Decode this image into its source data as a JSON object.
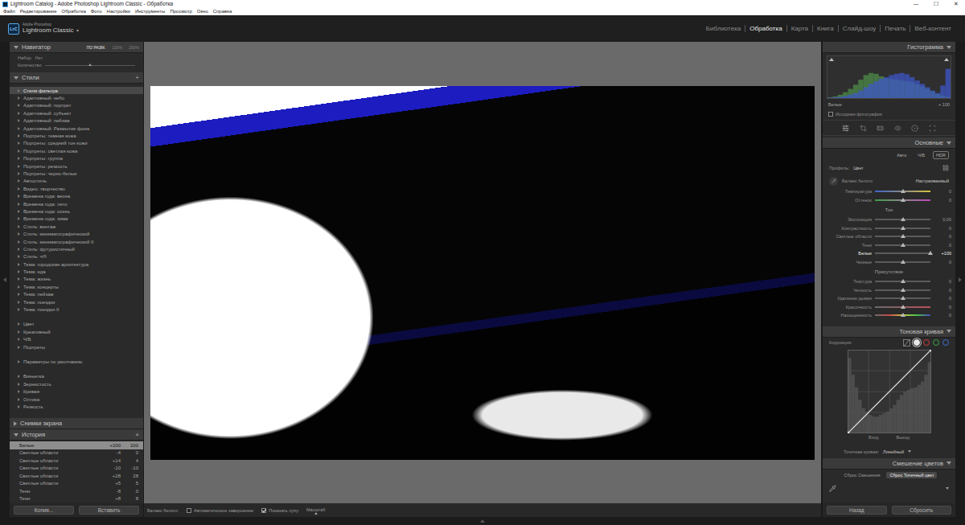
{
  "window": {
    "title": "Lightroom Catalog - Adobe Photoshop Lightroom Classic - Обработка",
    "controls": [
      "—",
      "☐",
      "✕"
    ]
  },
  "menu": [
    "Файл",
    "Редактирование",
    "Обработка",
    "Фото",
    "Настройки",
    "Инструменты",
    "Просмотр",
    "Окно",
    "Справка"
  ],
  "identity": {
    "logo": "LrC",
    "vendor": "Adobe Photoshop",
    "product": "Lightroom Classic",
    "caret": "▾"
  },
  "modules": [
    {
      "label": "Библиотека",
      "selected": false
    },
    {
      "label": "Обработка",
      "selected": true
    },
    {
      "label": "Карта",
      "selected": false
    },
    {
      "label": "Книга",
      "selected": false
    },
    {
      "label": "Слайд-шоу",
      "selected": false
    },
    {
      "label": "Печать",
      "selected": false
    },
    {
      "label": "Веб-контент",
      "selected": false
    }
  ],
  "left_panel": {
    "navigator": {
      "title": "Навигатор",
      "expanded": true,
      "zoom": [
        {
          "label": "ПО РАЗМ.",
          "selected": true
        },
        {
          "label": "100%",
          "selected": false
        },
        {
          "label": "200%",
          "selected": false
        }
      ],
      "preset_label": "Набор:",
      "preset_value": "Нет",
      "amount_label": "Количество",
      "amount_level": 0.5
    },
    "presets": {
      "title": "Стили",
      "expanded": true,
      "add": "+",
      "groups": [
        {
          "items": [
            {
              "label": "Стили фильтра",
              "selected": true
            },
            {
              "label": "Адаптивный: небо",
              "selected": false
            },
            {
              "label": "Адаптивный: портрет",
              "selected": false
            },
            {
              "label": "Адаптивный: субъект",
              "selected": false
            },
            {
              "label": "Адаптивный: пейзаж",
              "selected": false
            },
            {
              "label": "Адаптивный: Размытие фона",
              "selected": false
            },
            {
              "label": "Портреты: темная кожа",
              "selected": false
            },
            {
              "label": "Портреты: средний тон кожи",
              "selected": false
            },
            {
              "label": "Портреты: светлая кожа",
              "selected": false
            },
            {
              "label": "Портреты: группа",
              "selected": false
            },
            {
              "label": "Портреты: резкость",
              "selected": false
            },
            {
              "label": "Портреты: черно-белые",
              "selected": false
            },
            {
              "label": "Автостиль",
              "selected": false
            },
            {
              "label": "Видео: творчество",
              "selected": false
            },
            {
              "label": "Времена года: весна",
              "selected": false
            },
            {
              "label": "Времена года: лето",
              "selected": false
            },
            {
              "label": "Времена года: осень",
              "selected": false
            },
            {
              "label": "Времена года: зима",
              "selected": false
            },
            {
              "label": "Стиль: винтаж",
              "selected": false
            },
            {
              "label": "Стиль: кинематографический",
              "selected": false
            },
            {
              "label": "Стиль: кинематографический II",
              "selected": false
            },
            {
              "label": "Стиль: футуристичный",
              "selected": false
            },
            {
              "label": "Стиль: ч/б",
              "selected": false
            },
            {
              "label": "Тема: городская архитектура",
              "selected": false
            },
            {
              "label": "Тема: еда",
              "selected": false
            },
            {
              "label": "Тема: жизнь",
              "selected": false
            },
            {
              "label": "Тема: концерты",
              "selected": false
            },
            {
              "label": "Тема: пейзаж",
              "selected": false
            },
            {
              "label": "Тема: поездки",
              "selected": false
            },
            {
              "label": "Тема: поездки II",
              "selected": false
            }
          ]
        },
        {
          "items": [
            {
              "label": "Цвет",
              "selected": false
            },
            {
              "label": "Креативный",
              "selected": false
            },
            {
              "label": "Ч/Б",
              "selected": false
            },
            {
              "label": "Портреты",
              "selected": false
            }
          ]
        },
        {
          "items": [
            {
              "label": "Параметры по умолчанию",
              "selected": false
            }
          ]
        },
        {
          "items": [
            {
              "label": "Виньетка",
              "selected": false
            },
            {
              "label": "Зернистость",
              "selected": false
            },
            {
              "label": "Кривая",
              "selected": false
            },
            {
              "label": "Оптика",
              "selected": false
            },
            {
              "label": "Резкость",
              "selected": false
            }
          ]
        }
      ]
    },
    "snapshots": {
      "title": "Снимки экрана",
      "expanded": false
    },
    "history": {
      "title": "История",
      "expanded": true,
      "close": "×",
      "items": [
        {
          "label": "Белые",
          "change": "+100",
          "value": "100",
          "selected": true
        },
        {
          "label": "Светлые области",
          "change": "-4",
          "value": "0",
          "selected": false
        },
        {
          "label": "Светлые области",
          "change": "+14",
          "value": "4",
          "selected": false
        },
        {
          "label": "Светлые области",
          "change": "-10",
          "value": "-10",
          "selected": false
        },
        {
          "label": "Светлые области",
          "change": "+28",
          "value": "28",
          "selected": false
        },
        {
          "label": "Светлые области",
          "change": "+5",
          "value": "5",
          "selected": false
        },
        {
          "label": "Тени",
          "change": "-8",
          "value": "0",
          "selected": false
        },
        {
          "label": "Тени",
          "change": "+8",
          "value": "8",
          "selected": false
        }
      ]
    },
    "buttons": [
      "Копия...",
      "Вставить"
    ]
  },
  "toolbar": {
    "white_balance": "Баланс белого:",
    "checks": [
      {
        "label": "Автоматическое завершение",
        "checked": false
      },
      {
        "label": "Показать лупу",
        "checked": true
      }
    ],
    "zoom_label": "Масштаб",
    "zoom_level": 0.3
  },
  "right_panel": {
    "histogram": {
      "title": "Гистограмма",
      "expanded": true,
      "series": [
        {
          "name": "green",
          "color": "#4f8c49",
          "values": [
            2,
            4,
            8,
            14,
            22,
            32,
            44,
            55,
            60,
            58,
            52,
            47,
            45,
            44,
            42,
            40,
            38,
            33,
            28,
            22,
            16,
            10,
            6,
            3
          ]
        },
        {
          "name": "blue",
          "color": "#3d57c9",
          "values": [
            1,
            2,
            3,
            5,
            8,
            12,
            18,
            26,
            34,
            40,
            46,
            50,
            55,
            58,
            60,
            57,
            50,
            42,
            34,
            26,
            18,
            12,
            30,
            70
          ]
        }
      ],
      "readout_label": "Белые",
      "readout_value": "+ 100",
      "original": {
        "label": "Исходная фотография",
        "checked": false
      }
    },
    "tools": [
      {
        "kind": "adjust",
        "selected": true
      },
      {
        "kind": "crop",
        "selected": false
      },
      {
        "kind": "heal",
        "selected": false
      },
      {
        "kind": "redeye",
        "selected": false
      },
      {
        "kind": "mask",
        "selected": false
      },
      {
        "kind": "grid",
        "selected": false
      }
    ],
    "basic": {
      "title": "Основные",
      "expanded": true,
      "treatments": [
        {
          "label": "Авто",
          "kind": "button"
        },
        {
          "label": "Ч/Б",
          "kind": "button"
        },
        {
          "label": "HDR",
          "kind": "toggle"
        }
      ],
      "profile_label": "Профиль:",
      "profile_value": "Цвет",
      "wb_label": "Баланс белого:",
      "wb_value": "Настраиваемый",
      "wb_sliders": [
        {
          "label": "Температура",
          "value": "0",
          "level": 0.5,
          "kind": "temp",
          "active": false
        },
        {
          "label": "Оттенок",
          "value": "0",
          "level": 0.5,
          "kind": "tint",
          "active": false
        }
      ],
      "tone_label": "Тон",
      "tone": [
        {
          "label": "Экспозиция",
          "value": "0,00",
          "level": 0.5,
          "kind": "plain",
          "active": false
        },
        {
          "label": "Контрастность",
          "value": "0",
          "level": 0.5,
          "kind": "plain",
          "active": false
        },
        {
          "label": "Светлые области",
          "value": "0",
          "level": 0.5,
          "kind": "plain",
          "active": false
        },
        {
          "label": "Тени",
          "value": "0",
          "level": 0.5,
          "kind": "plain",
          "active": false
        },
        {
          "label": "Белые",
          "value": "+100",
          "level": 1,
          "kind": "plain",
          "active": true
        },
        {
          "label": "Черные",
          "value": "0",
          "level": 0.5,
          "kind": "plain",
          "active": false
        }
      ],
      "presence_label": "Присутствие",
      "presence": [
        {
          "label": "Текстура",
          "value": "0",
          "level": 0.5,
          "kind": "plain",
          "active": false
        },
        {
          "label": "Четкость",
          "value": "0",
          "level": 0.5,
          "kind": "plain",
          "active": false
        },
        {
          "label": "Удаление дымки",
          "value": "0",
          "level": 0.5,
          "kind": "plain",
          "active": false
        },
        {
          "label": "Красочность",
          "value": "0",
          "level": 0.5,
          "kind": "vibrance",
          "active": false
        },
        {
          "label": "Насыщенность",
          "value": "0",
          "level": 0.5,
          "kind": "saturation",
          "active": false
        }
      ]
    },
    "tone_curve": {
      "title": "Тоновая кривая",
      "expanded": true,
      "adjust_label": "Коррекция:",
      "channels": [
        {
          "kind": "parametric",
          "selected": false
        },
        {
          "kind": "point",
          "color": "#e8e8e8",
          "selected": true
        },
        {
          "kind": "point",
          "color": "#d23a3a",
          "selected": false
        },
        {
          "kind": "point",
          "color": "#3ba448",
          "selected": false
        },
        {
          "kind": "point",
          "color": "#3b6fd6",
          "selected": false
        }
      ],
      "histogram": [
        90,
        70,
        55,
        40,
        30,
        26,
        22,
        20,
        20,
        22,
        24,
        26,
        30,
        34,
        40,
        46,
        50,
        52,
        54,
        55,
        58,
        62,
        70,
        85
      ],
      "points": [
        {
          "in": 0,
          "out": 0
        },
        {
          "in": 255,
          "out": 255
        }
      ],
      "input_label": "Вход",
      "output_label": "Выход",
      "point_curve_label": "Точечная кривая:",
      "point_curve_value": "Линейный"
    },
    "color_mix": {
      "title": "Смешение цветов",
      "expanded": true,
      "buttons": [
        {
          "label": "Сброс Смешения",
          "selected": false
        },
        {
          "label": "Сброс Точечный цвет",
          "selected": true
        }
      ]
    },
    "buttons": [
      "Назад",
      "Сбросить"
    ]
  }
}
